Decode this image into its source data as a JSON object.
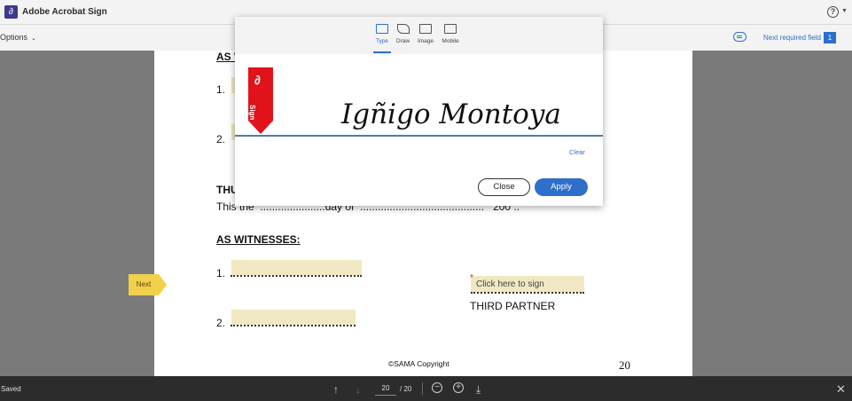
{
  "app": {
    "title": "Adobe Acrobat Sign"
  },
  "toolbar": {
    "options_label": "Options",
    "next_required_label": "Next required field",
    "required_count": "1"
  },
  "document": {
    "heading_top": "AS W",
    "item1": "1.",
    "item2": "2.",
    "thus_label": "THU",
    "this_line": "This the  ......................day of  ..........................................   200 ..",
    "witnesses_heading": "AS WITNESSES:",
    "w1": "1.",
    "w2": "2.",
    "click_to_sign": "Click here to sign",
    "asterisk": "*",
    "third_partner": "THIRD PARTNER",
    "copyright": "©SAMA Copyright",
    "page_number": "20",
    "next_tag": "Next"
  },
  "modal": {
    "tabs": [
      {
        "label": "Type",
        "icon": "keyboard-icon"
      },
      {
        "label": "Draw",
        "icon": "pen-icon"
      },
      {
        "label": "Image",
        "icon": "image-icon"
      },
      {
        "label": "Mobile",
        "icon": "mobile-icon"
      }
    ],
    "ribbon_text": "Sign",
    "signature_text": "Igñigo Montoya",
    "clear_label": "Clear",
    "close_label": "Close",
    "apply_label": "Apply"
  },
  "bottom": {
    "status": "Saved",
    "current_page": "20",
    "total_pages": "/ 20"
  },
  "colors": {
    "accent": "#2d6fcb",
    "ribbon": "#e2121b",
    "field_fill": "#efe8c2",
    "next_tag": "#f1d04b"
  }
}
